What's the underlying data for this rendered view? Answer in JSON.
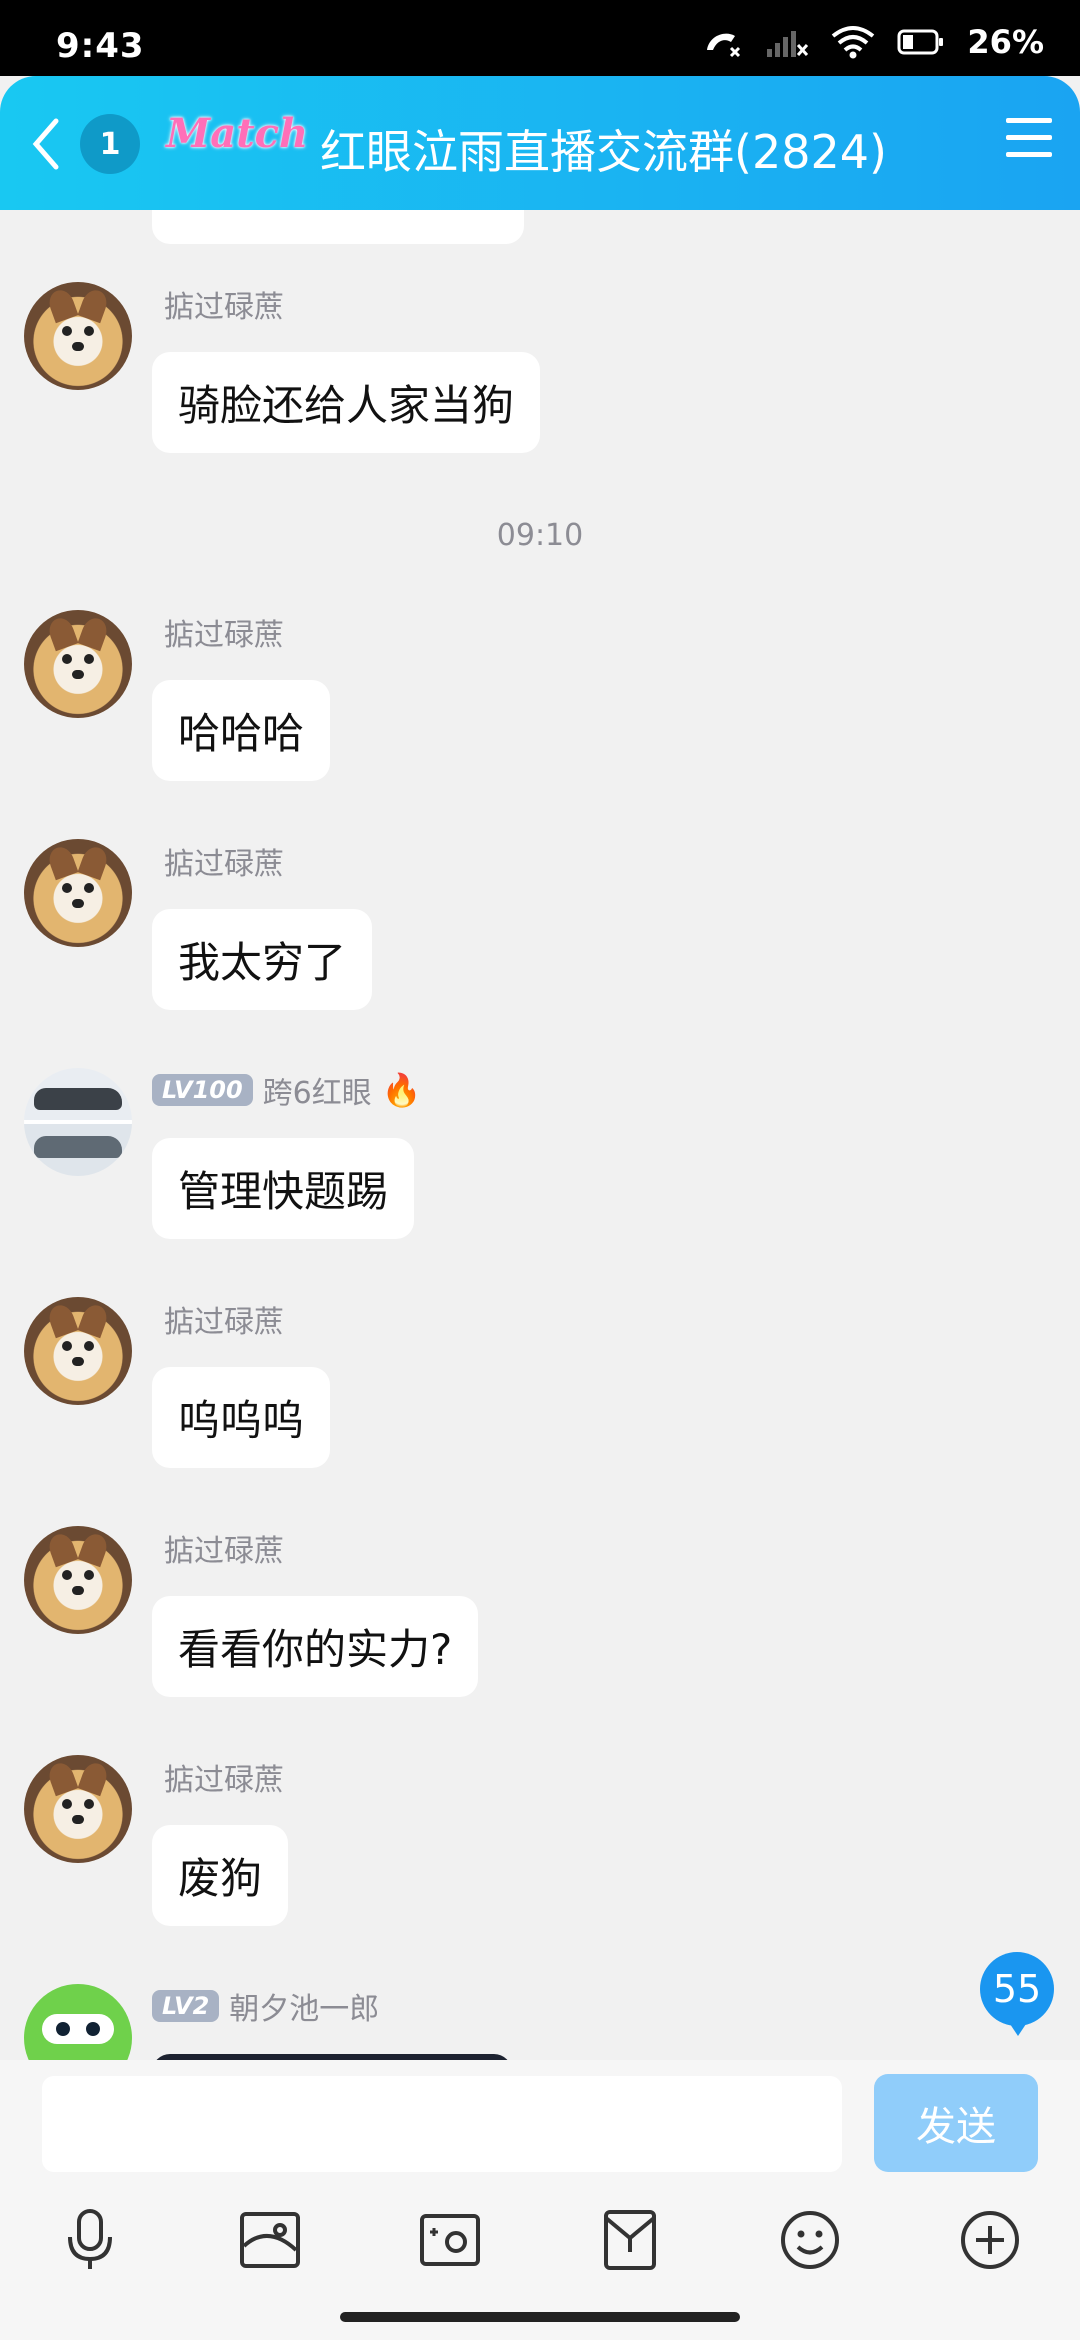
{
  "status_bar": {
    "time": "9:43",
    "battery": "26%"
  },
  "header": {
    "back_count": "1",
    "brand": "Match",
    "title": "红眼泣雨直播交流群(2824)"
  },
  "messages": [
    {
      "nick": "掂过碌蔗",
      "text": "骑脸还给人家当狗"
    },
    {
      "time": "09:10"
    },
    {
      "nick": "掂过碌蔗",
      "text": "哈哈哈"
    },
    {
      "nick": "掂过碌蔗",
      "text": "我太穷了"
    },
    {
      "level": "LV100",
      "nick": "跨6红眼",
      "text": "管理快题踢"
    },
    {
      "nick": "掂过碌蔗",
      "text": "呜呜呜"
    },
    {
      "nick": "掂过碌蔗",
      "text": "看看你的实力?"
    },
    {
      "nick": "掂过碌蔗",
      "text": "废狗"
    },
    {
      "level": "LV2",
      "nick": "朝夕池一郎"
    }
  ],
  "unread_count": "55",
  "input": {
    "send_label": "发送"
  },
  "toolbar": [
    "microphone-icon",
    "image-icon",
    "camera-icon",
    "red-packet-icon",
    "emoji-icon",
    "plus-icon"
  ],
  "colors": {
    "header_start": "#19c8f2",
    "header_end": "#1aa4f2",
    "send_button": "#90cdfa",
    "badge": "#1a96f0"
  }
}
